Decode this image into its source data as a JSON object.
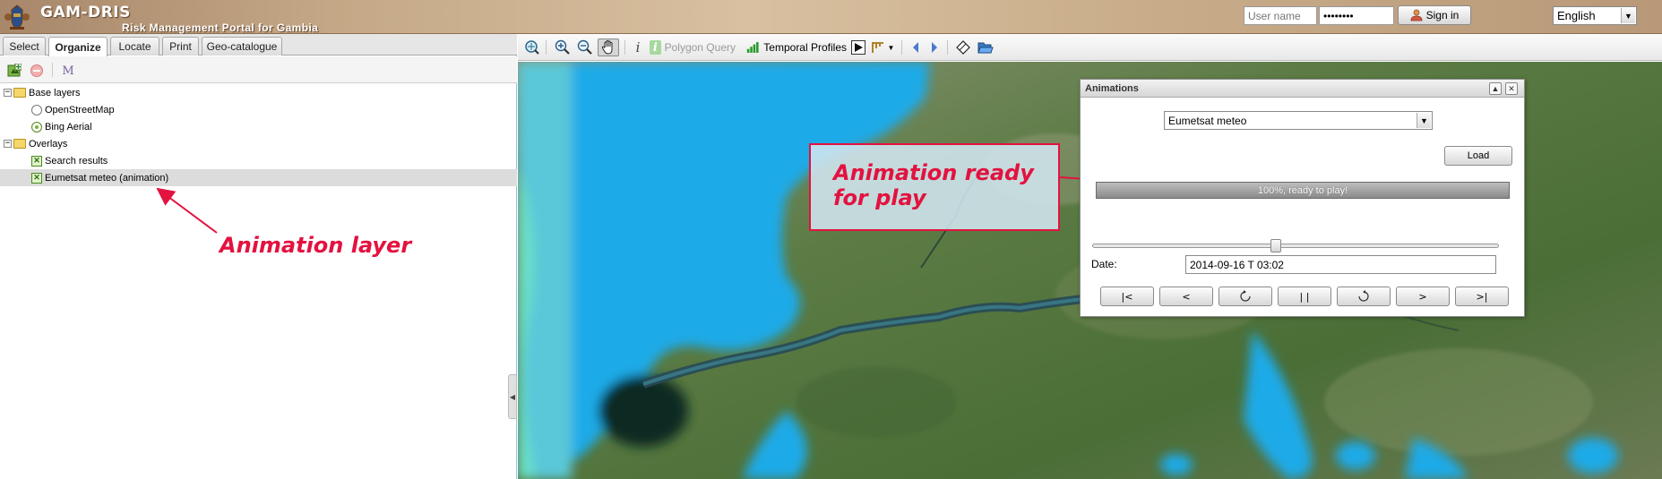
{
  "header": {
    "title": "GAM-DRIS",
    "subtitle": "Risk Management Portal for Gambia",
    "username_placeholder": "User name",
    "password_value": "••••••••",
    "signin_label": "Sign in",
    "language": "English"
  },
  "left_panel": {
    "tabs": [
      "Select",
      "Organize",
      "Locate",
      "Print",
      "Geo-catalogue"
    ],
    "active_tab": "Organize",
    "tree": {
      "base_layers": "Base layers",
      "osm": "OpenStreetMap",
      "bing": "Bing Aerial",
      "overlays": "Overlays",
      "search_results": "Search results",
      "eumetsat": "Eumetsat meteo (animation)"
    },
    "tool_m": "M"
  },
  "map_toolbar": {
    "polygon_query": "Polygon Query",
    "temporal_profiles": "Temporal Profiles"
  },
  "annotations": {
    "animation_layer": "Animation layer",
    "ready_line1": "Animation ready",
    "ready_line2": "for play"
  },
  "animation_panel": {
    "title": "Animations",
    "selected_layer": "Eumetsat meteo",
    "load_label": "Load",
    "progress_percent": 100,
    "progress_text": "100%, ready to play!",
    "slider_position": 0.45,
    "date_label": "Date:",
    "date_value": "2014-09-16 T 03:02",
    "controls": [
      "|<",
      "<",
      "",
      "| |",
      "",
      ">",
      ">|"
    ]
  },
  "colors": {
    "accent_red": "#e3123f",
    "water": "#1ba8ea",
    "land": "#4f7a3a"
  }
}
